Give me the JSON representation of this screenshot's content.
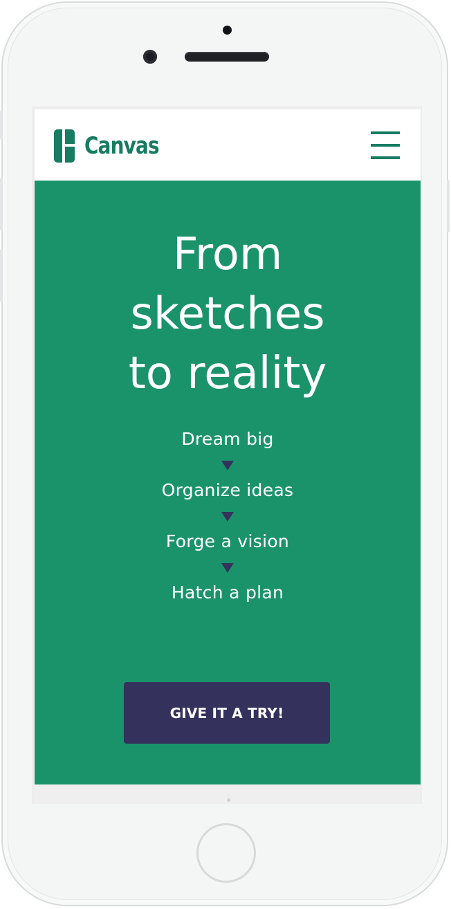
{
  "app": {
    "brand": "Canvas",
    "brand_color": "#177c61"
  },
  "header": {
    "logo_icon": "canvas-logo-icon",
    "menu_icon": "hamburger-menu-icon"
  },
  "hero": {
    "background": "#1a936b",
    "headline": [
      "From",
      "sketches",
      "to reality"
    ],
    "steps": [
      "Dream big",
      "Organize ideas",
      "Forge a vision",
      "Hatch a plan"
    ],
    "arrow_icon": "triangle-down-icon",
    "arrow_color": "#34335c",
    "cta_label": "GIVE IT A TRY!",
    "cta_color": "#34325c"
  }
}
